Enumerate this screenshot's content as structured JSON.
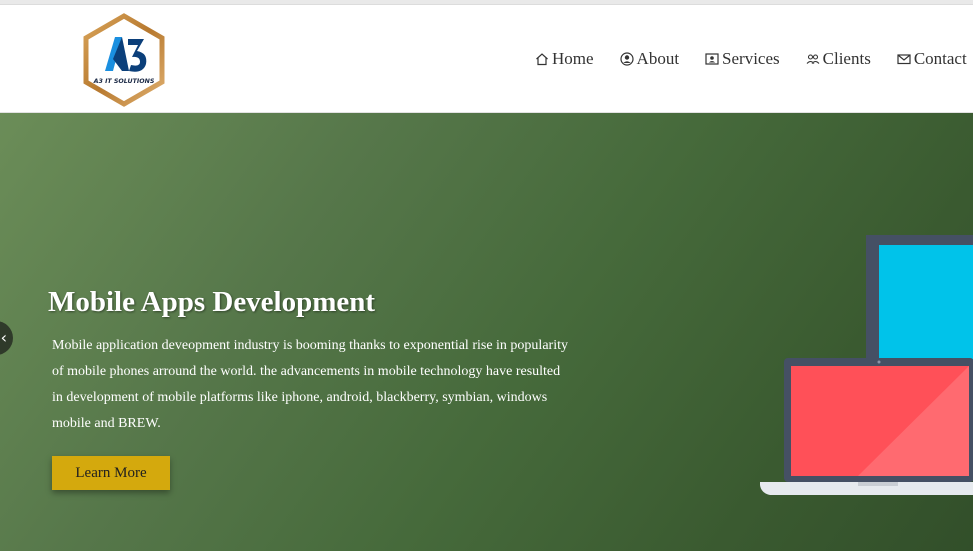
{
  "brand": {
    "logo_text": "A3",
    "logo_subtext": "A3 IT SOLUTIONS"
  },
  "nav": {
    "items": [
      {
        "label": "Home",
        "icon": "home-icon"
      },
      {
        "label": "About",
        "icon": "user-circle-icon"
      },
      {
        "label": "Services",
        "icon": "id-card-icon"
      },
      {
        "label": "Clients",
        "icon": "people-icon"
      },
      {
        "label": "Contact",
        "icon": "envelope-icon"
      }
    ]
  },
  "hero": {
    "title": "Mobile Apps Development",
    "description": "Mobile application deveopment industry is booming thanks to exponential rise in popularity of mobile phones arround the world. the advancements in mobile technology have resulted in development of mobile platforms like iphone, android, blackberry, symbian, windows mobile and BREW.",
    "button_label": "Learn More",
    "prev_arrow": "‹"
  },
  "colors": {
    "accent": "#d4a90d",
    "hero_bg": "#4f7243",
    "screen_cyan": "#00c3ea",
    "screen_red": "#ff5058"
  }
}
